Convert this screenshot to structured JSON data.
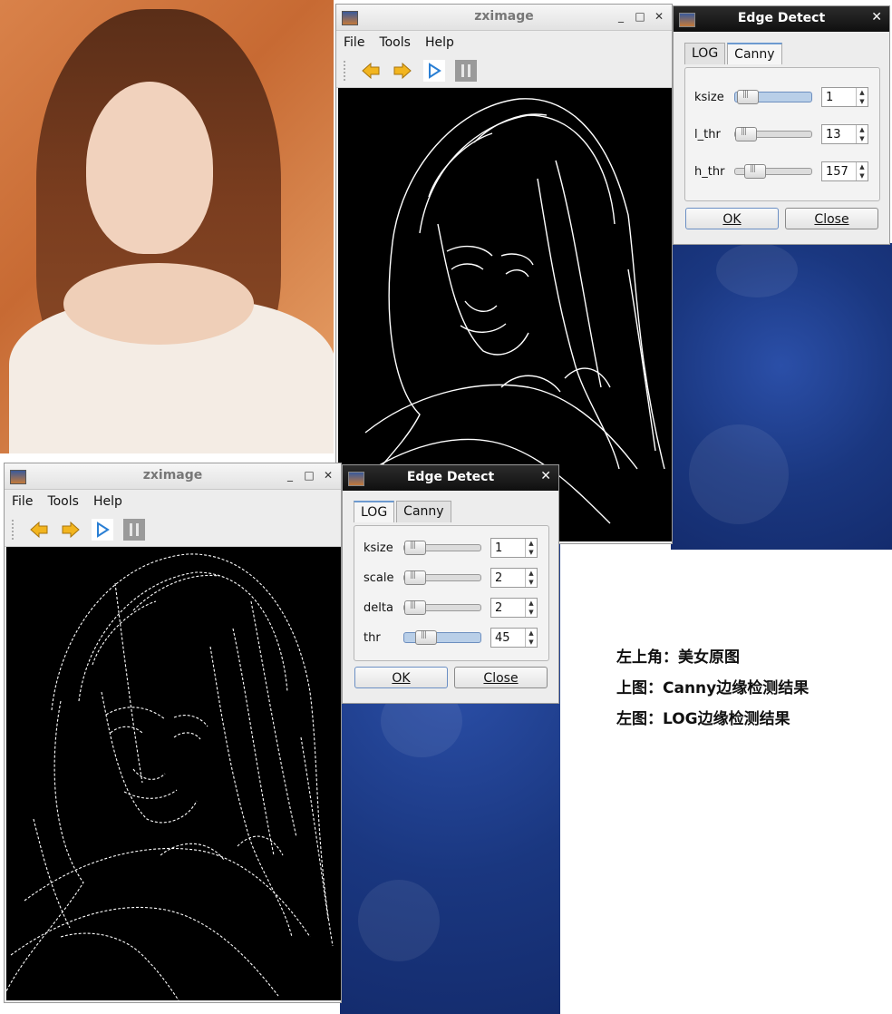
{
  "canny_window": {
    "title": "zximage",
    "menu": [
      "File",
      "Tools",
      "Help"
    ]
  },
  "canny_dialog": {
    "title": "Edge Detect",
    "tabs": [
      "LOG",
      "Canny"
    ],
    "active_tab": "Canny",
    "params": [
      {
        "label": "ksize",
        "value": "1",
        "level": 0.05
      },
      {
        "label": "l_thr",
        "value": "13",
        "level": 0.05
      },
      {
        "label": "h_thr",
        "value": "157",
        "level": 0.2
      }
    ],
    "ok_label": "OK",
    "close_label": "Close"
  },
  "log_window": {
    "title": "zximage",
    "menu": [
      "File",
      "Tools",
      "Help"
    ]
  },
  "log_dialog": {
    "title": "Edge Detect",
    "tabs": [
      "LOG",
      "Canny"
    ],
    "active_tab": "LOG",
    "params": [
      {
        "label": "ksize",
        "value": "1",
        "level": 0.05
      },
      {
        "label": "scale",
        "value": "2",
        "level": 0.05
      },
      {
        "label": "delta",
        "value": "2",
        "level": 0.05
      },
      {
        "label": "thr",
        "value": "45",
        "level": 0.18
      }
    ],
    "ok_label": "OK",
    "close_label": "Close"
  },
  "captions": [
    "左上角：美女原图",
    "上图：Canny边缘检测结果",
    "左图：LOG边缘检测结果"
  ],
  "colors": {
    "desktop_blue": "#1b3a86",
    "accent": "#6c9ad0",
    "arrow_yellow": "#f2b51f",
    "play_blue": "#2a7fd4"
  }
}
